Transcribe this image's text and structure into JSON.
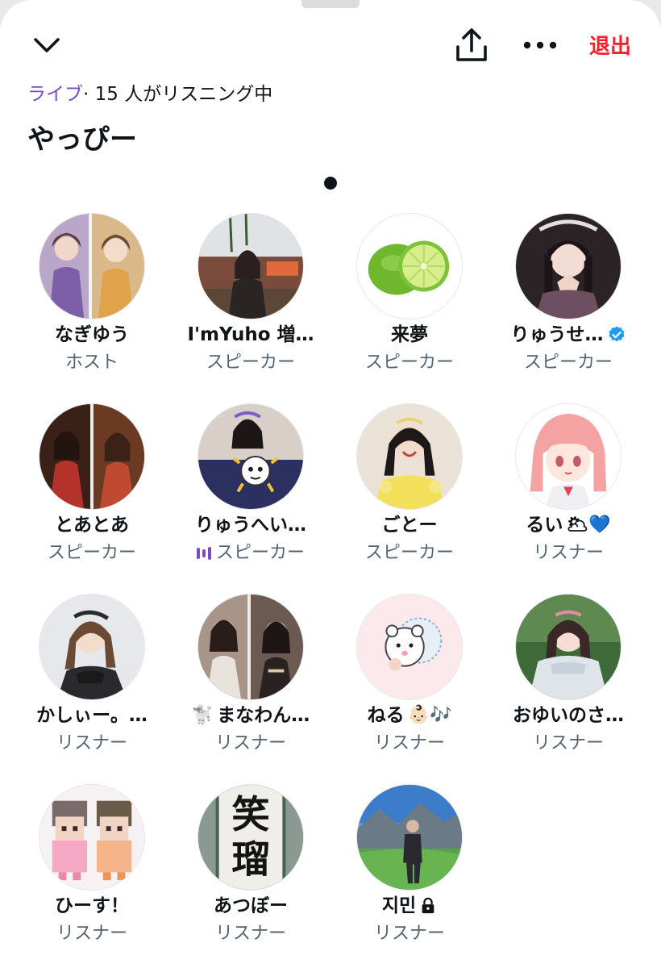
{
  "header": {
    "leave_label": "退出",
    "icons": [
      "chevron-down-icon",
      "share-icon",
      "more-icon"
    ]
  },
  "space": {
    "status_live": "ライブ",
    "status_count": "· 15 人がリスニング中",
    "title": "やっぴー"
  },
  "colors": {
    "accent": "#794bc4",
    "leave": "#f4212e",
    "verified": "#1d9bf0"
  },
  "participants": [
    {
      "name": "なぎゆう",
      "role": "ホスト"
    },
    {
      "name": "I'mYuho 増…",
      "role": "スピーカー"
    },
    {
      "name": "来夢",
      "role": "スピーカー"
    },
    {
      "name": "りゅうせ…",
      "role": "スピーカー",
      "verified": true
    },
    {
      "name": "とあとあ",
      "role": "スピーカー"
    },
    {
      "name": "りゅうへい…",
      "role": "スピーカー",
      "speaking": true
    },
    {
      "name": "ごとー",
      "role": "スピーカー"
    },
    {
      "name": "るい",
      "name_suffix": "🌥💙",
      "role": "リスナー"
    },
    {
      "name": "かしぃー。…",
      "role": "リスナー"
    },
    {
      "name_prefix": "🐩",
      "name": "まなわん…",
      "role": "リスナー"
    },
    {
      "name": "ねる",
      "name_suffix": "👶🏻🎶",
      "role": "リスナー"
    },
    {
      "name": "おゆいのさ…",
      "role": "リスナー"
    },
    {
      "name": "ひーす！",
      "role": "リスナー"
    },
    {
      "name": "あつぼー",
      "role": "リスナー"
    },
    {
      "name": "지민",
      "role": "リスナー",
      "locked": true
    }
  ],
  "avatar_texts": {
    "laugh_char_1": "笑",
    "laugh_char_2": "瑠"
  }
}
